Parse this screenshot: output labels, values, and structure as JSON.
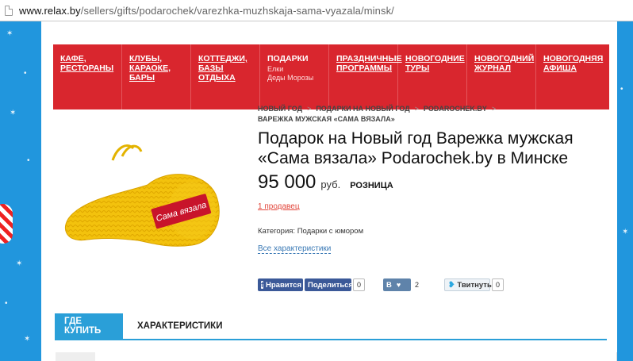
{
  "browser": {
    "url_host": "www.relax.by",
    "url_path": "/sellers/gifts/podarochek/varezhka-muzhskaja-sama-vyazala/minsk/"
  },
  "nav": {
    "items": [
      {
        "label": "КАФЕ, РЕСТОРАНЫ",
        "sub": ""
      },
      {
        "label": "КЛУБЫ, КАРАОКЕ, БАРЫ",
        "sub": ""
      },
      {
        "label": "КОТТЕДЖИ, БАЗЫ ОТДЫХА",
        "sub": ""
      },
      {
        "label": "ПОДАРКИ",
        "sub": "Елки\nДеды Морозы"
      },
      {
        "label": "ПРАЗДНИЧНЫЕ ПРОГРАММЫ",
        "sub": ""
      },
      {
        "label": "НОВОГОДНИЕ ТУРЫ",
        "sub": ""
      },
      {
        "label": "НОВОГОДНИЙ ЖУРНАЛ",
        "sub": ""
      },
      {
        "label": "НОВОГОДНЯЯ АФИША",
        "sub": ""
      }
    ]
  },
  "breadcrumb": {
    "items": [
      "НОВЫЙ ГОД",
      "ПОДАРКИ НА НОВЫЙ ГОД",
      "PODAROCHEK.BY",
      "ВАРЕЖКА МУЖСКАЯ «САМА ВЯЗАЛА»"
    ],
    "separator": ">"
  },
  "product": {
    "title": "Подарок на Новый год Варежка мужская «Сама вязала» Podarochek.by в Минске",
    "price": "95 000",
    "currency": "руб.",
    "price_type": "РОЗНИЦА",
    "sellers_link": "1 продавец",
    "category": "Категория: Подарки с юмором",
    "all_chars_link": "Все характеристики",
    "image_tag_text": "Сама вязала"
  },
  "social": {
    "fb_like": "Нравится",
    "fb_share": "Поделиться",
    "fb_count": "0",
    "vk_label": "В",
    "vk_count": "2",
    "tw_label": "Твитнуть",
    "tw_count": "0"
  },
  "tabs": [
    {
      "label": "ГДЕ КУПИТЬ",
      "active": true
    },
    {
      "label": "ХАРАКТЕРИСТИКИ",
      "active": false
    }
  ],
  "colors": {
    "nav_red": "#d9262e",
    "accent_blue": "#2a9fd8",
    "price_link_red": "#e2453a",
    "side_blue": "#2196dd"
  }
}
